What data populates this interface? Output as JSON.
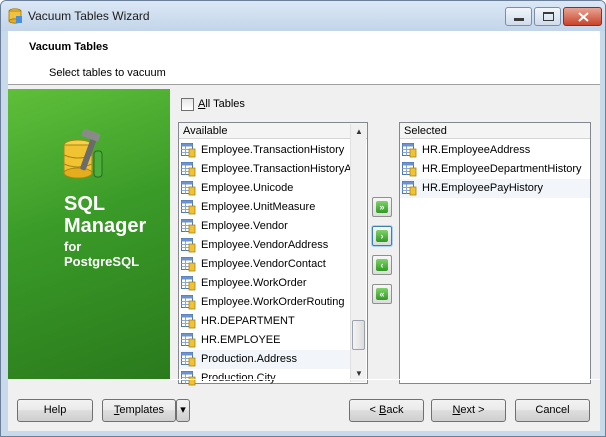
{
  "window": {
    "title": "Vacuum Tables Wizard"
  },
  "header": {
    "title": "Vacuum Tables",
    "subtitle": "Select tables to vacuum"
  },
  "banner": {
    "line1": "SQL",
    "line2": "Manager",
    "line3": "for",
    "line4": "PostgreSQL"
  },
  "all_tables": {
    "label_first": "A",
    "label_rest": "ll Tables",
    "checked": false
  },
  "available": {
    "header": "Available",
    "items": [
      "Employee.TransactionHistory",
      "Employee.TransactionHistoryA",
      "Employee.Unicode",
      "Employee.UnitMeasure",
      "Employee.Vendor",
      "Employee.VendorAddress",
      "Employee.VendorContact",
      "Employee.WorkOrder",
      "Employee.WorkOrderRouting",
      "HR.DEPARTMENT",
      "HR.EMPLOYEE",
      "Production.Address",
      "Production.City"
    ]
  },
  "selected": {
    "header": "Selected",
    "items": [
      "HR.EmployeeAddress",
      "HR.EmployeeDepartmentHistory",
      "HR.EmployeePayHistory"
    ]
  },
  "move_buttons": {
    "add_all": "»",
    "add": "›",
    "remove": "‹",
    "remove_all": "«"
  },
  "buttons": {
    "help": "Help",
    "templates_first": "T",
    "templates_rest": "emplates",
    "templates_arrow": "▾",
    "back_prefix": "< ",
    "back_first": "B",
    "back_rest": "ack",
    "next_first": "N",
    "next_rest": "ext >",
    "cancel": "Cancel"
  },
  "colors": {
    "banner_green": "#3a9a28",
    "accent_blue": "#3c7fb1"
  }
}
